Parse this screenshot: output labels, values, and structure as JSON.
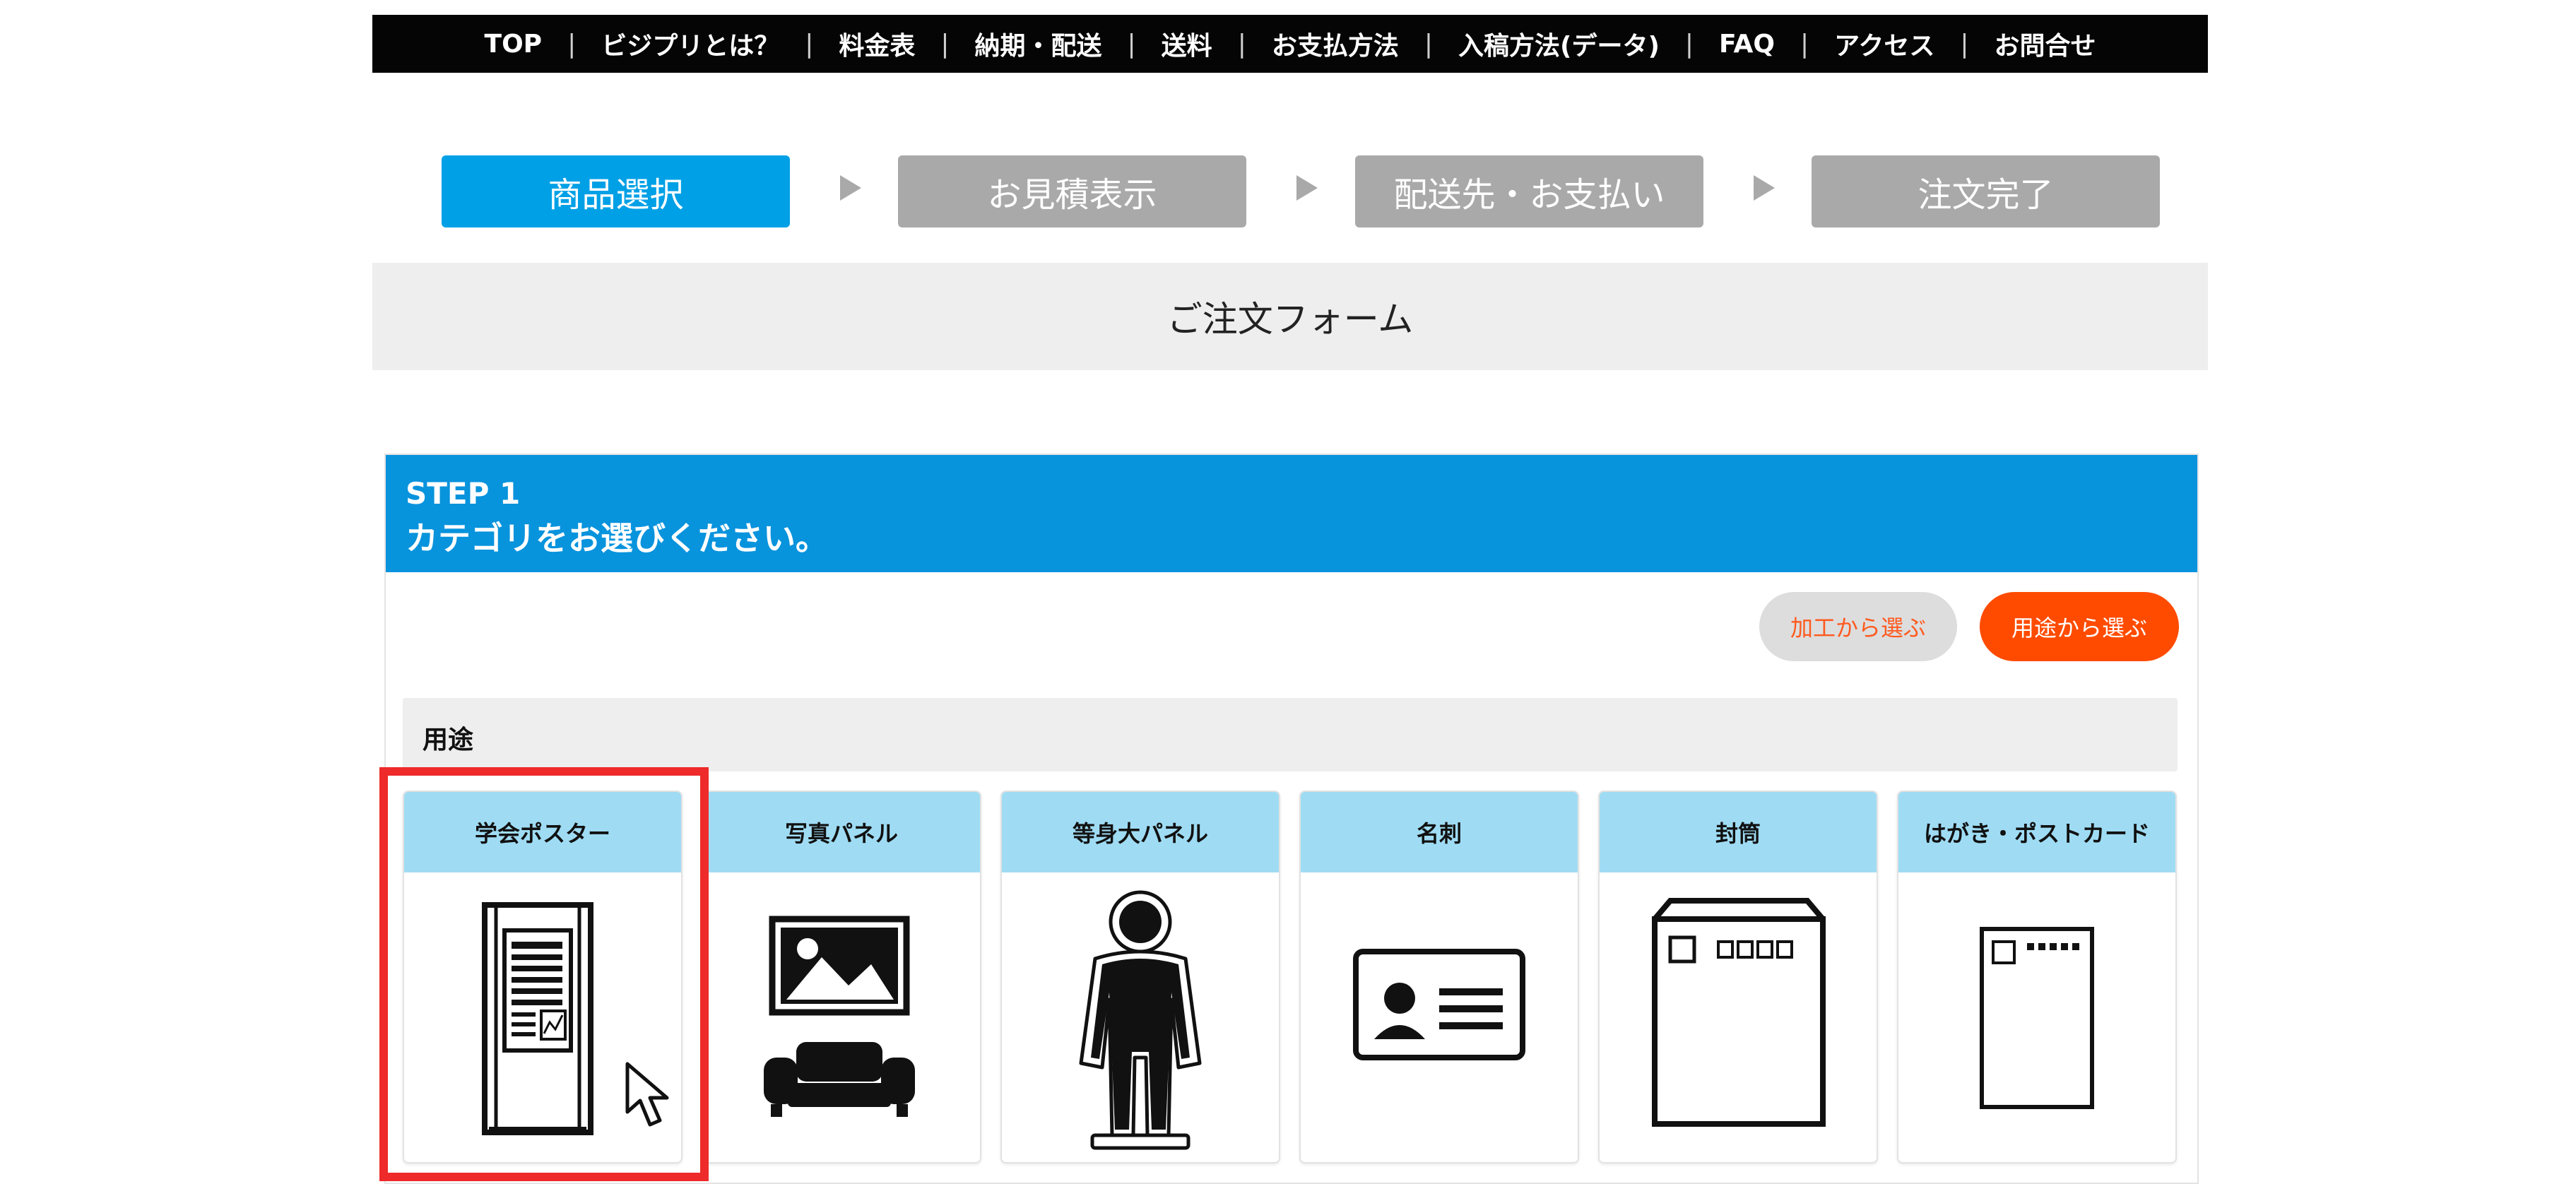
{
  "nav": {
    "items": [
      "TOP",
      "ビジプリとは？",
      "料金表",
      "納期・配送",
      "送料",
      "お支払方法",
      "入稿方法(データ)",
      "FAQ",
      "アクセス",
      "お問合せ"
    ],
    "separator": "|"
  },
  "steps": [
    "商品選択",
    "お見積表示",
    "配送先・お支払い",
    "注文完了"
  ],
  "form_title": "ご注文フォーム",
  "step_panel": {
    "step_label": "STEP 1",
    "instruction": "カテゴリをお選びください。",
    "toggle_buttons": {
      "by_process": "加工から選ぶ",
      "by_use": "用途から選ぶ"
    },
    "section_title": "用途",
    "categories": [
      {
        "label": "学会ポスター",
        "icon": "academic-poster-icon",
        "selected": true
      },
      {
        "label": "写真パネル",
        "icon": "photo-panel-icon"
      },
      {
        "label": "等身大パネル",
        "icon": "life-size-panel-icon"
      },
      {
        "label": "名刺",
        "icon": "business-card-icon"
      },
      {
        "label": "封筒",
        "icon": "envelope-icon"
      },
      {
        "label": "はがき・ポストカード",
        "icon": "postcard-icon"
      }
    ]
  },
  "colors": {
    "active_step": "#00a0e6",
    "inactive_step": "#a9a9a9",
    "panel_header": "#0893dd",
    "card_title_bg": "#9fdcf4",
    "primary_button": "#ff4b00",
    "highlight": "#ee2a2a"
  }
}
